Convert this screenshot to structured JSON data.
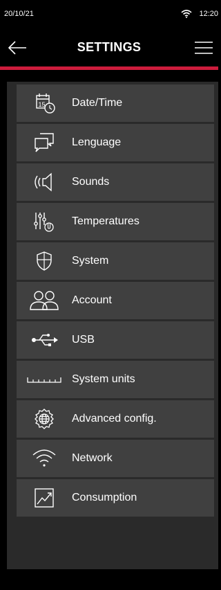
{
  "status": {
    "date": "20/10/21",
    "time": "12:20",
    "wifi_icon": "wifi-icon"
  },
  "header": {
    "title": "SETTINGS",
    "back_icon": "back-arrow-icon",
    "menu_icon": "menu-icon"
  },
  "colors": {
    "accent": "#cc1c3c",
    "item_bg": "#404040",
    "panel_bg": "#2a2a2a",
    "background": "#000000"
  },
  "menu": {
    "items": [
      {
        "label": "Date/Time",
        "icon": "calendar-clock-icon"
      },
      {
        "label": "Lenguage",
        "icon": "speech-bubbles-icon"
      },
      {
        "label": "Sounds",
        "icon": "speaker-icon"
      },
      {
        "label": "Temperatures",
        "icon": "sliders-thermometer-icon"
      },
      {
        "label": "System",
        "icon": "shield-icon"
      },
      {
        "label": "Account",
        "icon": "users-icon"
      },
      {
        "label": "USB",
        "icon": "usb-icon"
      },
      {
        "label": "System units",
        "icon": "ruler-icon"
      },
      {
        "label": "Advanced config.",
        "icon": "gear-globe-icon"
      },
      {
        "label": "Network",
        "icon": "wifi-icon"
      },
      {
        "label": "Consumption",
        "icon": "trend-chart-icon"
      }
    ]
  }
}
